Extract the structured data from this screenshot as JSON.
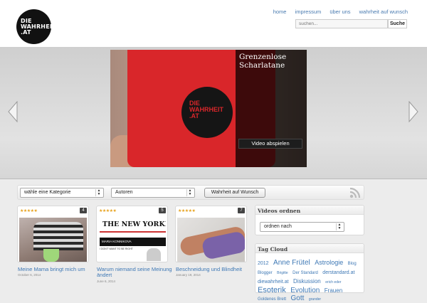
{
  "header": {
    "logo_lines": [
      "DIE",
      "WAHRHEIT",
      ".AT"
    ],
    "nav": [
      "home",
      "impressum",
      "über uns",
      "wahrheit auf wunsch"
    ],
    "search_placeholder": "suchen...",
    "search_button": "Suche"
  },
  "slider": {
    "caption_title": "Grenzenlose Scharlatane",
    "play_button": "Video abspielen",
    "shirt_logo_lines": [
      "DIE",
      "WAHRHEIT",
      ".AT"
    ]
  },
  "filters": {
    "category": "wähle eine Kategorie",
    "author": "Autoren",
    "wish_button": "Wahrheit auf Wunsch"
  },
  "articles": [
    {
      "stars": "★★★★★",
      "count": "4",
      "title": "Meine Mama bringt mich um",
      "date": "October 6, 2014"
    },
    {
      "stars": "★★★★★",
      "count": "5",
      "title": "Warum niemand seine Meinung ändert",
      "date": "June 6, 2014",
      "thumb_head": "THE NEW YORKER",
      "thumb_bar": "MARIA KONNIKOVA",
      "thumb_text": "I DON'T WANT TO BE RIGHT"
    },
    {
      "stars": "★★★★★",
      "count": "7",
      "title": "Beschneidung und Blindheit",
      "date": "January 19, 2014"
    }
  ],
  "sidebar": {
    "videos_title": "Videos ordnen",
    "order_select": "ordnen nach",
    "tag_title": "Tag Cloud",
    "tags": [
      {
        "t": "2012",
        "s": 7
      },
      {
        "t": "Anne Frütel",
        "s": 10
      },
      {
        "t": "Astrologie",
        "s": 9
      },
      {
        "t": "Blog",
        "s": 6
      },
      {
        "t": "Blogger",
        "s": 6
      },
      {
        "t": "Brigitte",
        "s": 5
      },
      {
        "t": "Der Standard",
        "s": 6
      },
      {
        "t": "derstandard.at",
        "s": 7
      },
      {
        "t": "diewahrheit.at",
        "s": 7
      },
      {
        "t": "Diskussion",
        "s": 8
      },
      {
        "t": "erich eder",
        "s": 5
      },
      {
        "t": "Esoterik",
        "s": 11
      },
      {
        "t": "Evolution",
        "s": 10
      },
      {
        "t": "Frauen",
        "s": 8
      },
      {
        "t": "Goldenes Brett",
        "s": 6
      },
      {
        "t": "Gott",
        "s": 10
      },
      {
        "t": "grander",
        "s": 5
      }
    ]
  },
  "colors": {
    "link": "#3e78b5",
    "nav": "#4a7bb0",
    "shirt": "#d9262a",
    "star": "#e7a21d"
  }
}
